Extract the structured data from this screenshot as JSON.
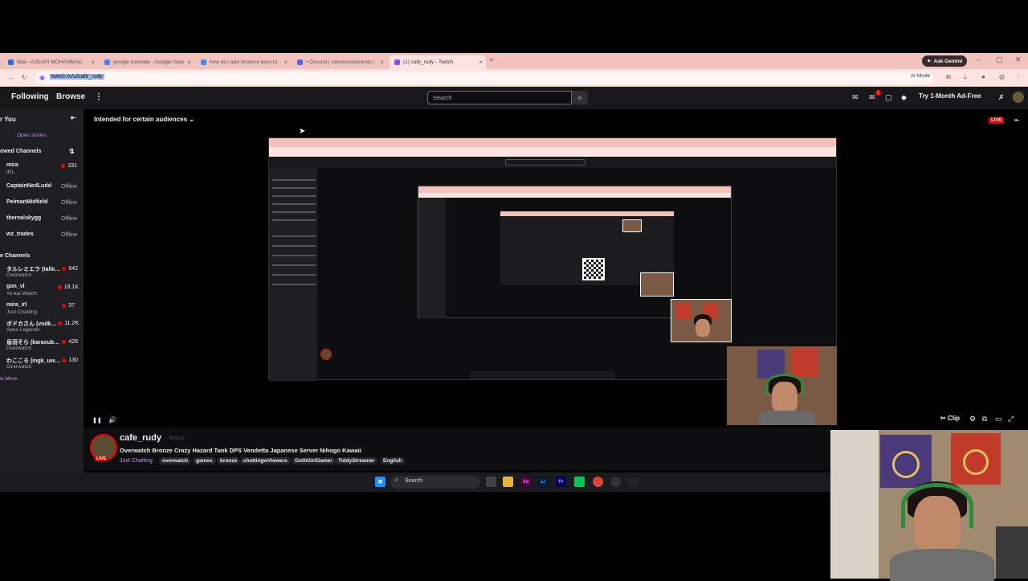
{
  "browser": {
    "tabs": [
      {
        "title": "Mail - AJDARI MOHAMMAD",
        "color": "#1a73e8",
        "active": false
      },
      {
        "title": "google translate - Google Sear",
        "color": "#4285f4",
        "active": false
      },
      {
        "title": "how do i add shortcut keys to",
        "color": "#4285f4",
        "active": false
      },
      {
        "title": "• Discord | #announcements |",
        "color": "#5865f2",
        "active": false
      },
      {
        "title": "(1) cafe_rudy - Twitch",
        "color": "#9146ff",
        "active": true
      }
    ],
    "close_glyph": "×",
    "new_tab_glyph": "+",
    "ask_gemini": "Ask Gemini",
    "url": "twitch.tv/u/cafe_rudy",
    "ai_mode": "AI Mode"
  },
  "twitch_nav": {
    "following": "Following",
    "browse": "Browse",
    "more": "⋮",
    "search_placeholder": "Search",
    "notif_count": "1",
    "ad_free": "Try 1-Month Ad-Free"
  },
  "sidebar": {
    "for_you": "r You",
    "open_stories": "Open stories",
    "followed_header": "owed Channels",
    "followed": [
      {
        "name": "mira",
        "sub": "IRL",
        "viewers": "331",
        "live": true
      },
      {
        "name": "CaptainNedLudd",
        "sub": "",
        "viewers": "Offline",
        "live": false
      },
      {
        "name": "PeimanMidfield",
        "sub": "",
        "viewers": "Offline",
        "live": false
      },
      {
        "name": "therealskygg",
        "sub": "",
        "viewers": "Offline",
        "live": false
      },
      {
        "name": "wz_trades",
        "sub": "",
        "viewers": "Offline",
        "live": false
      }
    ],
    "live_header": "e Channels",
    "live": [
      {
        "name": "タルレミエラ (talle…",
        "sub": "Overwatch",
        "viewers": "642"
      },
      {
        "name": "gon_vl",
        "sub": "Yo-kai Watch",
        "viewers": "18.1K"
      },
      {
        "name": "mira_irl",
        "sub": "Just Chatting",
        "viewers": "37"
      },
      {
        "name": "ボドカさん (vodk…",
        "sub": "Apex Legends",
        "viewers": "11.2K"
      },
      {
        "name": "烏羽そら (karasub…",
        "sub": "Overwatch",
        "viewers": "426"
      },
      {
        "name": "わこころ (ingk_uw…",
        "sub": "Overwatch",
        "viewers": "130"
      }
    ],
    "show_more": "w More"
  },
  "player": {
    "audience": "Intended for certain audiences",
    "live_badge": "LIVE",
    "clip": "Clip",
    "pause_glyph": "❚❚",
    "volume_glyph": "🔊"
  },
  "channel": {
    "name": "cafe_rudy",
    "knock": "Knock",
    "live_badge": "LIVE",
    "title": "Overwatch Bronze Crazy Hazard Tank DPS Vendetta Japanese Server Nihogo Kawaii",
    "category": "Just Chatting",
    "tags": [
      "overwatch",
      "games",
      "bronze",
      "chattingwViewers",
      "GothGirlGamer",
      "TiddyStreamer",
      "English"
    ]
  },
  "taskbar": {
    "search": "Search"
  },
  "colors": {
    "twitch_purple": "#9146ff",
    "live_red": "#eb0400",
    "chrome_tab": "#f2c3bd"
  }
}
